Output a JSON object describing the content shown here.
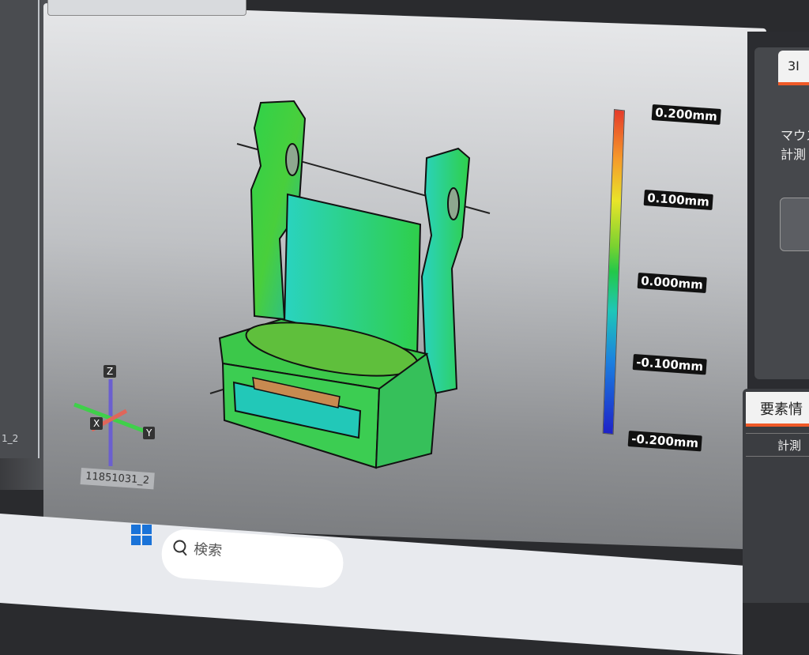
{
  "legend": {
    "ticks": [
      "0.200mm",
      "0.100mm",
      "0.000mm",
      "-0.100mm",
      "-0.200mm"
    ]
  },
  "axes": {
    "z": "Z",
    "x": "X",
    "y": "Y"
  },
  "model": {
    "name": "11851031_2"
  },
  "left_panel": {
    "label": "1_2"
  },
  "right_panel": {
    "tab1": "3I",
    "text_line1": "マウス",
    "text_line2": "計測",
    "tab2": "要素情",
    "column_header": "計測"
  },
  "taskbar": {
    "search_placeholder": "検索"
  },
  "colors": {
    "accent": "#f05a28",
    "legend_top": "#e53b2a",
    "legend_mid": "#22c84a",
    "legend_bottom": "#1e22c8",
    "model_green": "#3cc84a"
  },
  "icons": [
    "windows-icon",
    "search-icon"
  ]
}
